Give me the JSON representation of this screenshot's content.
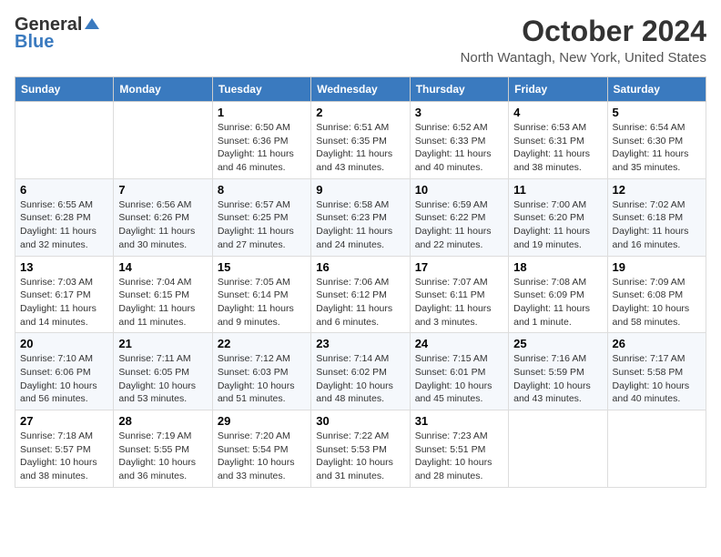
{
  "logo": {
    "general": "General",
    "blue": "Blue"
  },
  "title": "October 2024",
  "subtitle": "North Wantagh, New York, United States",
  "weekdays": [
    "Sunday",
    "Monday",
    "Tuesday",
    "Wednesday",
    "Thursday",
    "Friday",
    "Saturday"
  ],
  "weeks": [
    [
      {
        "day": "",
        "info": ""
      },
      {
        "day": "",
        "info": ""
      },
      {
        "day": "1",
        "info": "Sunrise: 6:50 AM\nSunset: 6:36 PM\nDaylight: 11 hours and 46 minutes."
      },
      {
        "day": "2",
        "info": "Sunrise: 6:51 AM\nSunset: 6:35 PM\nDaylight: 11 hours and 43 minutes."
      },
      {
        "day": "3",
        "info": "Sunrise: 6:52 AM\nSunset: 6:33 PM\nDaylight: 11 hours and 40 minutes."
      },
      {
        "day": "4",
        "info": "Sunrise: 6:53 AM\nSunset: 6:31 PM\nDaylight: 11 hours and 38 minutes."
      },
      {
        "day": "5",
        "info": "Sunrise: 6:54 AM\nSunset: 6:30 PM\nDaylight: 11 hours and 35 minutes."
      }
    ],
    [
      {
        "day": "6",
        "info": "Sunrise: 6:55 AM\nSunset: 6:28 PM\nDaylight: 11 hours and 32 minutes."
      },
      {
        "day": "7",
        "info": "Sunrise: 6:56 AM\nSunset: 6:26 PM\nDaylight: 11 hours and 30 minutes."
      },
      {
        "day": "8",
        "info": "Sunrise: 6:57 AM\nSunset: 6:25 PM\nDaylight: 11 hours and 27 minutes."
      },
      {
        "day": "9",
        "info": "Sunrise: 6:58 AM\nSunset: 6:23 PM\nDaylight: 11 hours and 24 minutes."
      },
      {
        "day": "10",
        "info": "Sunrise: 6:59 AM\nSunset: 6:22 PM\nDaylight: 11 hours and 22 minutes."
      },
      {
        "day": "11",
        "info": "Sunrise: 7:00 AM\nSunset: 6:20 PM\nDaylight: 11 hours and 19 minutes."
      },
      {
        "day": "12",
        "info": "Sunrise: 7:02 AM\nSunset: 6:18 PM\nDaylight: 11 hours and 16 minutes."
      }
    ],
    [
      {
        "day": "13",
        "info": "Sunrise: 7:03 AM\nSunset: 6:17 PM\nDaylight: 11 hours and 14 minutes."
      },
      {
        "day": "14",
        "info": "Sunrise: 7:04 AM\nSunset: 6:15 PM\nDaylight: 11 hours and 11 minutes."
      },
      {
        "day": "15",
        "info": "Sunrise: 7:05 AM\nSunset: 6:14 PM\nDaylight: 11 hours and 9 minutes."
      },
      {
        "day": "16",
        "info": "Sunrise: 7:06 AM\nSunset: 6:12 PM\nDaylight: 11 hours and 6 minutes."
      },
      {
        "day": "17",
        "info": "Sunrise: 7:07 AM\nSunset: 6:11 PM\nDaylight: 11 hours and 3 minutes."
      },
      {
        "day": "18",
        "info": "Sunrise: 7:08 AM\nSunset: 6:09 PM\nDaylight: 11 hours and 1 minute."
      },
      {
        "day": "19",
        "info": "Sunrise: 7:09 AM\nSunset: 6:08 PM\nDaylight: 10 hours and 58 minutes."
      }
    ],
    [
      {
        "day": "20",
        "info": "Sunrise: 7:10 AM\nSunset: 6:06 PM\nDaylight: 10 hours and 56 minutes."
      },
      {
        "day": "21",
        "info": "Sunrise: 7:11 AM\nSunset: 6:05 PM\nDaylight: 10 hours and 53 minutes."
      },
      {
        "day": "22",
        "info": "Sunrise: 7:12 AM\nSunset: 6:03 PM\nDaylight: 10 hours and 51 minutes."
      },
      {
        "day": "23",
        "info": "Sunrise: 7:14 AM\nSunset: 6:02 PM\nDaylight: 10 hours and 48 minutes."
      },
      {
        "day": "24",
        "info": "Sunrise: 7:15 AM\nSunset: 6:01 PM\nDaylight: 10 hours and 45 minutes."
      },
      {
        "day": "25",
        "info": "Sunrise: 7:16 AM\nSunset: 5:59 PM\nDaylight: 10 hours and 43 minutes."
      },
      {
        "day": "26",
        "info": "Sunrise: 7:17 AM\nSunset: 5:58 PM\nDaylight: 10 hours and 40 minutes."
      }
    ],
    [
      {
        "day": "27",
        "info": "Sunrise: 7:18 AM\nSunset: 5:57 PM\nDaylight: 10 hours and 38 minutes."
      },
      {
        "day": "28",
        "info": "Sunrise: 7:19 AM\nSunset: 5:55 PM\nDaylight: 10 hours and 36 minutes."
      },
      {
        "day": "29",
        "info": "Sunrise: 7:20 AM\nSunset: 5:54 PM\nDaylight: 10 hours and 33 minutes."
      },
      {
        "day": "30",
        "info": "Sunrise: 7:22 AM\nSunset: 5:53 PM\nDaylight: 10 hours and 31 minutes."
      },
      {
        "day": "31",
        "info": "Sunrise: 7:23 AM\nSunset: 5:51 PM\nDaylight: 10 hours and 28 minutes."
      },
      {
        "day": "",
        "info": ""
      },
      {
        "day": "",
        "info": ""
      }
    ]
  ]
}
